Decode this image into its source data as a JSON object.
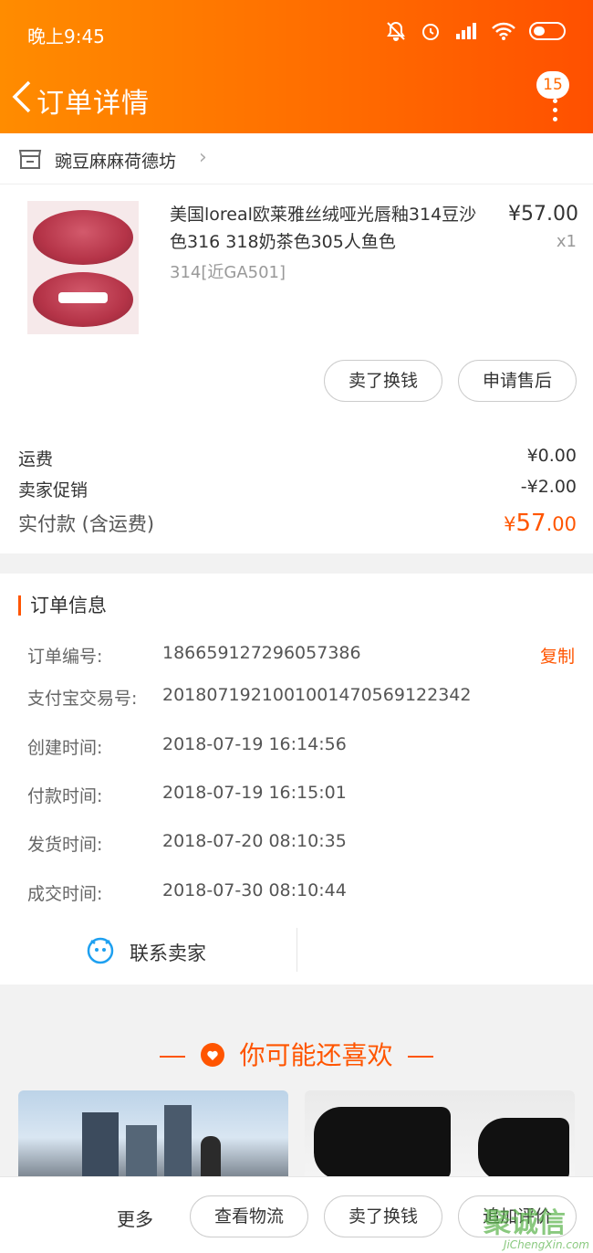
{
  "status_bar": {
    "time": "晚上9:45"
  },
  "nav": {
    "title": "订单详情",
    "badge_count": "15"
  },
  "shop": {
    "name": "豌豆麻麻荷德坊"
  },
  "product": {
    "title": "美国loreal欧莱雅丝绒哑光唇釉314豆沙色316 318奶茶色305人鱼色",
    "sku": "314[近GA501]",
    "price": "¥57.00",
    "quantity": "x1"
  },
  "item_actions": {
    "sell_label": "卖了换钱",
    "after_sale_label": "申请售后"
  },
  "fees": {
    "shipping_label": "运费",
    "shipping_value": "¥0.00",
    "promo_label": "卖家促销",
    "promo_value": "-¥2.00",
    "total_label": "实付款 (含运费)",
    "total_currency": "¥",
    "total_int": "57",
    "total_dec": ".00"
  },
  "order_info": {
    "title": "订单信息",
    "copy_label": "复制",
    "rows": [
      {
        "k": "订单编号:",
        "v": "186659127296057386"
      },
      {
        "k": "支付宝交易号:",
        "v": "2018071921001001470569122342"
      },
      {
        "k": "创建时间:",
        "v": "2018-07-19 16:14:56"
      },
      {
        "k": "付款时间:",
        "v": "2018-07-19 16:15:01"
      },
      {
        "k": "发货时间:",
        "v": "2018-07-20 08:10:35"
      },
      {
        "k": "成交时间:",
        "v": "2018-07-30 08:10:44"
      }
    ],
    "contact_label": "联系卖家"
  },
  "recommend": {
    "title": "你可能还喜欢"
  },
  "bottom_bar": {
    "more_label": "更多",
    "logistics_label": "查看物流",
    "sell_label": "卖了换钱",
    "review_label": "追加评价"
  },
  "watermark": {
    "big": "聚诚信",
    "small": "JiChengXin.com"
  },
  "colors": {
    "accent": "#ff5500",
    "header_start": "#ff8c00",
    "header_end": "#ff5000"
  },
  "icons": [
    "back-icon",
    "more-icon",
    "shop-icon",
    "chevron-right-icon",
    "contact-icon",
    "heart-icon",
    "mute-icon",
    "alarm-icon",
    "signal-icon",
    "wifi-icon",
    "battery-icon"
  ]
}
